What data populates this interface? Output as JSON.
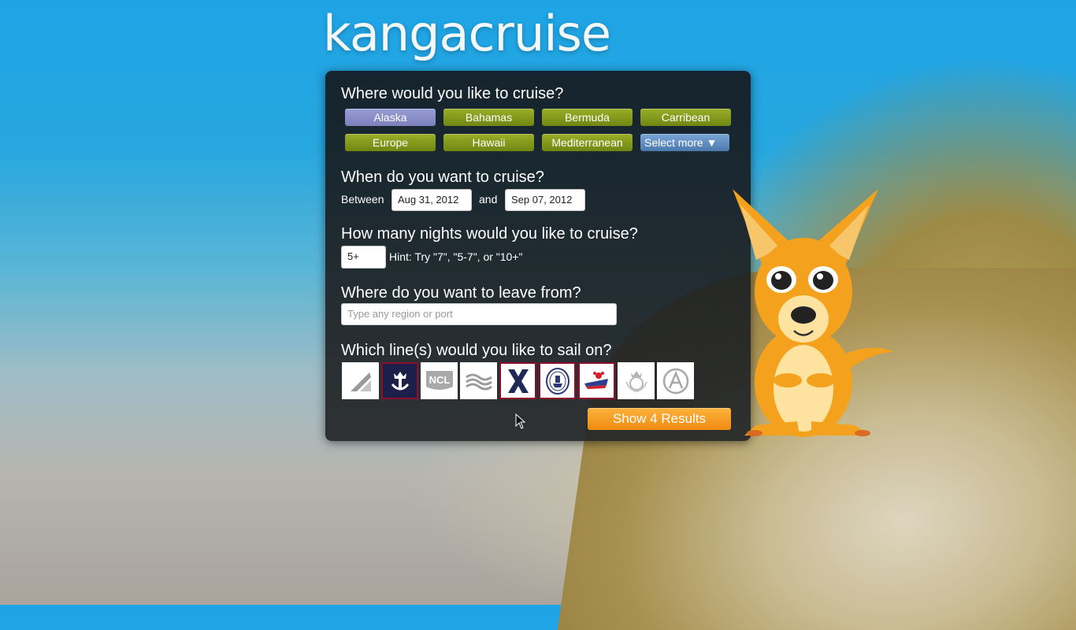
{
  "site": {
    "logo": "kangacruise"
  },
  "destinations": {
    "question": "Where would you like to cruise?",
    "options": [
      {
        "label": "Alaska",
        "selected": true
      },
      {
        "label": "Bahamas",
        "selected": false
      },
      {
        "label": "Bermuda",
        "selected": false
      },
      {
        "label": "Carribean",
        "selected": false
      },
      {
        "label": "Europe",
        "selected": false
      },
      {
        "label": "Hawaii",
        "selected": false
      },
      {
        "label": "Mediterranean",
        "selected": false
      }
    ],
    "more_label": "Select more ▼"
  },
  "dates": {
    "question": "When do you want to cruise?",
    "between_label": "Between",
    "and_label": "and",
    "start": "Aug 31, 2012",
    "end": "Sep 07, 2012"
  },
  "nights": {
    "question": "How many nights would you like to cruise?",
    "value": "5+",
    "hint": "Hint: Try \"7\", \"5-7\", or \"10+\""
  },
  "departure": {
    "question": "Where do you want to leave from?",
    "placeholder": "Type any region or port"
  },
  "cruise_lines": {
    "question": "Which line(s) would you like to sail on?",
    "lines": [
      {
        "icon": "carnival-logo-icon",
        "selected": false
      },
      {
        "icon": "royal-caribbean-logo-icon",
        "selected": true
      },
      {
        "icon": "ncl-logo-icon",
        "selected": false,
        "text": "NCL"
      },
      {
        "icon": "princess-logo-icon",
        "selected": false
      },
      {
        "icon": "celebrity-logo-icon",
        "selected": true
      },
      {
        "icon": "holland-america-logo-icon",
        "selected": true
      },
      {
        "icon": "disney-logo-icon",
        "selected": true
      },
      {
        "icon": "cunard-logo-icon",
        "selected": false
      },
      {
        "icon": "azamara-logo-icon",
        "selected": false
      }
    ]
  },
  "results_button": "Show 4 Results",
  "colors": {
    "option_green": "#86a01d",
    "option_selected": "#8a8ecb",
    "button_orange": "#f59b22",
    "line_selected_border": "#8b0f2b"
  }
}
